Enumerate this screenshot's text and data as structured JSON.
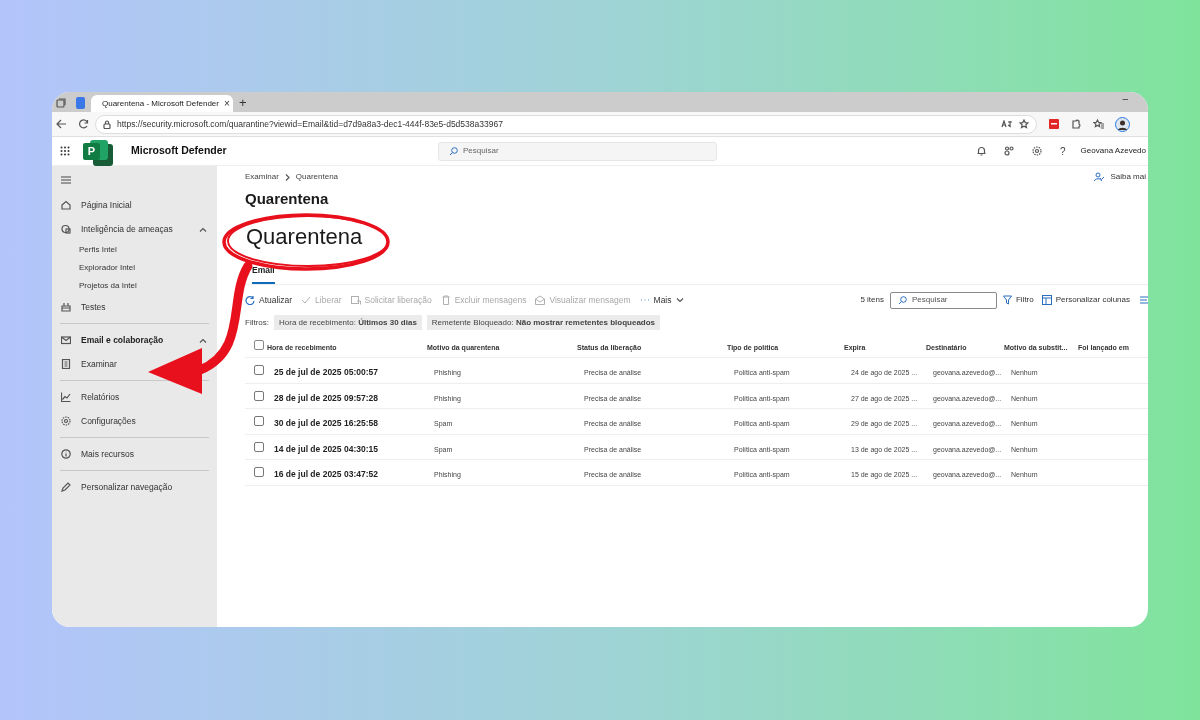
{
  "browser": {
    "tab_title": "Quarentena - Microsoft Defender",
    "tab_close": "×",
    "new_tab": "+",
    "minimize": "–",
    "url": "https://security.microsoft.com/quarantine?viewid=Email&tid=d7d9a8a3-dec1-444f-83e5-d5d538a33967"
  },
  "header": {
    "logo_letter": "P",
    "app_name": "Microsoft Defender",
    "search_placeholder": "Pesquisar",
    "help": "?",
    "user": "Geovana Azevedo"
  },
  "sidebar": {
    "sections": [
      [
        {
          "label": "Página Inicial"
        },
        {
          "label": "Inteligência de ameaças",
          "kind": "group",
          "expanded": true,
          "children": [
            {
              "label": "Perfis Intel"
            },
            {
              "label": "Explorador Intel"
            },
            {
              "label": "Projetos da Intel"
            }
          ]
        },
        {
          "label": "Testes"
        }
      ],
      [
        {
          "label": "Email e colaboração",
          "kind": "header",
          "expanded": true,
          "children": [
            {
              "label": "Examinar"
            }
          ]
        }
      ],
      [
        {
          "label": "Relatórios"
        },
        {
          "label": "Configurações"
        }
      ],
      [
        {
          "label": "Mais recursos"
        }
      ],
      [
        {
          "label": "Personalizar navegação"
        }
      ]
    ]
  },
  "main": {
    "breadcrumb": [
      "Examinar",
      "Quarentena"
    ],
    "learn_more": "Saiba mai",
    "title": "Quarentena",
    "annotation": "Quarentena",
    "tabs": [
      {
        "label": "Email",
        "selected": true
      }
    ],
    "actions": [
      {
        "label": "Atualizar",
        "disabled": false
      },
      {
        "label": "Liberar",
        "disabled": true
      },
      {
        "label": "Solicitar liberação",
        "disabled": true
      },
      {
        "label": "Excluir mensagens",
        "disabled": true
      },
      {
        "label": "Visualizar mensagem",
        "disabled": true
      },
      {
        "label": "Mais",
        "disabled": false
      }
    ],
    "count": "5 itens",
    "search_placeholder": "Pesquisar",
    "filter": "Filtro",
    "customize": "Personalizar colunas",
    "filters_label": "Filtros:",
    "filters": [
      "Hora de recebimento: **Últimos 30 dias**",
      "Remetente Bloqueado: **Não mostrar remetentes bloqueados**"
    ],
    "table": {
      "all_selected": false,
      "columns": [
        "Hora de recebimento",
        "Motivo da quarentena",
        "Status da liberação",
        "Tipo de política",
        "Expira",
        "Destinatário",
        "Motivo da substit...",
        "Foi lançado em"
      ],
      "rows": [
        {
          "selected": false,
          "cells": [
            "25 de jul de 2025 05:00:57",
            "Phishing",
            "Precisa de análise",
            "Política anti-spam",
            "24 de ago de 2025 ...",
            "geovana.azevedo@...",
            "Nenhum"
          ]
        },
        {
          "selected": false,
          "cells": [
            "28 de jul de 2025 09:57:28",
            "Phishing",
            "Precisa de análise",
            "Política anti-spam",
            "27 de ago de 2025 ...",
            "geovana.azevedo@...",
            "Nenhum"
          ]
        },
        {
          "selected": false,
          "cells": [
            "30 de jul de 2025 16:25:58",
            "Spam",
            "Precisa de análise",
            "Política anti-spam",
            "29 de ago de 2025 ...",
            "geovana.azevedo@...",
            "Nenhum"
          ]
        },
        {
          "selected": false,
          "cells": [
            "14 de jul de 2025 04:30:15",
            "Spam",
            "Precisa de análise",
            "Política anti-spam",
            "13 de ago de 2025 ...",
            "geovana.azevedo@...",
            "Nenhum"
          ]
        },
        {
          "selected": false,
          "cells": [
            "16 de jul de 2025 03:47:52",
            "Phishing",
            "Precisa de análise",
            "Política anti-spam",
            "15 de ago de 2025 ...",
            "geovana.azevedo@...",
            "Nenhum"
          ]
        }
      ]
    }
  }
}
